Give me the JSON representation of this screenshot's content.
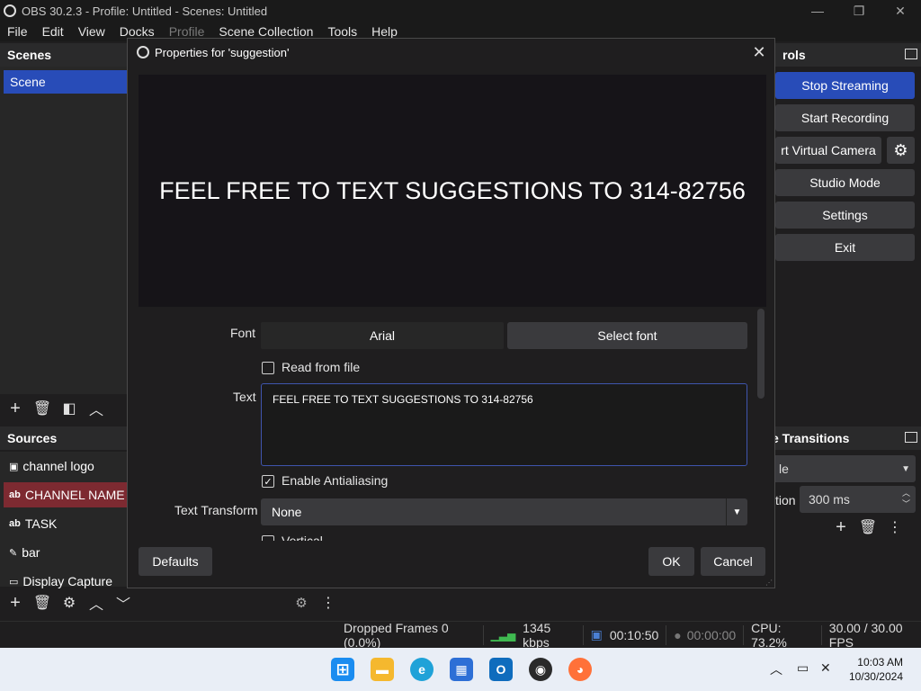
{
  "window": {
    "title": "OBS 30.2.3 - Profile: Untitled - Scenes: Untitled",
    "minimize": "—",
    "maximize": "❐",
    "close": "✕"
  },
  "menu": {
    "items": [
      "File",
      "Edit",
      "View",
      "Docks",
      "Profile",
      "Scene Collection",
      "Tools",
      "Help"
    ]
  },
  "scenes": {
    "header": "Scenes",
    "items": [
      "Scene"
    ]
  },
  "sources": {
    "header": "Sources",
    "items": [
      {
        "label": "channel logo",
        "icon": "▣"
      },
      {
        "label": "CHANNEL NAME",
        "icon": "ab"
      },
      {
        "label": "TASK",
        "icon": "ab"
      },
      {
        "label": "bar",
        "icon": "✎"
      },
      {
        "label": "Display Capture",
        "icon": "▭"
      }
    ]
  },
  "controls": {
    "header": "rols",
    "stop_streaming": "Stop Streaming",
    "start_recording": "Start Recording",
    "virtual_camera": "rt Virtual Camera",
    "studio_mode": "Studio Mode",
    "settings": "Settings",
    "exit": "Exit"
  },
  "transitions": {
    "header": "e Transitions",
    "transition_value": "le",
    "duration_label": "tion",
    "duration_value": "300 ms"
  },
  "dialog": {
    "title": "Properties for 'suggestion'",
    "preview_text": "FEEL FREE TO TEXT SUGGESTIONS TO 314-82756",
    "font_label": "Font",
    "font_value": "Arial",
    "select_font": "Select font",
    "read_from_file": "Read from file",
    "text_label": "Text",
    "text_value": "FEEL FREE TO TEXT SUGGESTIONS TO 314-82756",
    "enable_antialiasing": "Enable Antialiasing",
    "text_transform_label": "Text Transform",
    "text_transform_value": "None",
    "vertical": "Vertical",
    "defaults": "Defaults",
    "ok": "OK",
    "cancel": "Cancel"
  },
  "status": {
    "dropped_frames": "Dropped Frames 0 (0.0%)",
    "bitrate": "1345 kbps",
    "stream_time": "00:10:50",
    "record_time": "00:00:00",
    "cpu": "CPU: 73.2%",
    "fps": "30.00 / 30.00 FPS"
  },
  "taskbar": {
    "time": "10:03 AM",
    "date": "10/30/2024"
  },
  "colors": {
    "accent": "#284cb8",
    "selected_source": "#7d2a31",
    "bitrate_good": "#3fb950"
  }
}
